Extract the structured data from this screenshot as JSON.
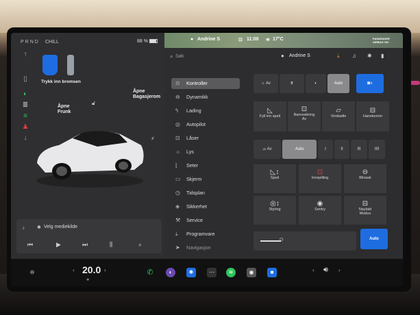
{
  "status": {
    "gear": "PRND",
    "mode": "CHILL",
    "battery": "88 %"
  },
  "brake": {
    "hint": "Trykk inn bromsen"
  },
  "car_labels": {
    "frunk": "Åpne\nFrunk",
    "trunk": "Åpne\nBagasjerom"
  },
  "media": {
    "source": "Velg mediekilde"
  },
  "topbar": {
    "user": "Andrine S",
    "time": "11:00",
    "temp": "17°C",
    "airbag": "PASSENGER AIRBAG ON"
  },
  "search": {
    "placeholder": "Søk"
  },
  "profile": {
    "name": "Andrine S"
  },
  "nav": [
    {
      "label": "Kontroller",
      "icon": "toggle-icon"
    },
    {
      "label": "Dynamikk",
      "icon": "car-icon"
    },
    {
      "label": "Lading",
      "icon": "bolt-icon"
    },
    {
      "label": "Autopilot",
      "icon": "steering-icon"
    },
    {
      "label": "Låser",
      "icon": "lock-icon"
    },
    {
      "label": "Lys",
      "icon": "bulb-icon"
    },
    {
      "label": "Seter",
      "icon": "seat-icon"
    },
    {
      "label": "Skjerm",
      "icon": "screen-icon"
    },
    {
      "label": "Tidsplan",
      "icon": "clock-icon"
    },
    {
      "label": "Sikkerhet",
      "icon": "shield-icon"
    },
    {
      "label": "Service",
      "icon": "wrench-icon"
    },
    {
      "label": "Programvare",
      "icon": "download-icon"
    },
    {
      "label": "Navigasjon",
      "icon": "nav-icon"
    }
  ],
  "lights": {
    "off": "Av",
    "auto": "Auto"
  },
  "quick": [
    {
      "label": "Fyll inn speil"
    },
    {
      "label": "Barnesikring",
      "sub": "Av"
    },
    {
      "label": "Vindsølle"
    },
    {
      "label": "Hanskerom"
    }
  ],
  "wipers": {
    "off": "Av",
    "auto": "Auto",
    "speeds": [
      "I",
      "II",
      "III",
      "IIII"
    ]
  },
  "adjust": [
    {
      "label": "Speil"
    },
    {
      "label": "Innspilling"
    },
    {
      "label": "Bilvask"
    },
    {
      "label": "Styring"
    },
    {
      "label": "Sentry"
    },
    {
      "label": "Naylaid",
      "sub": "Modus"
    }
  ],
  "brightness": {
    "auto": "Auto"
  },
  "dock": {
    "temperature": "20.0"
  }
}
